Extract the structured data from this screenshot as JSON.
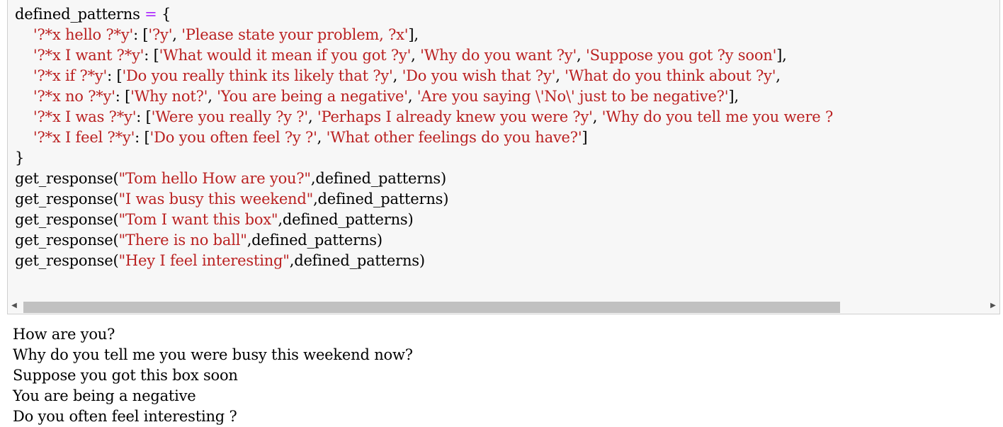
{
  "code": {
    "lines": [
      [
        {
          "t": "defined_patterns ",
          "c": ""
        },
        {
          "t": "=",
          "c": "op"
        },
        {
          "t": " {",
          "c": ""
        }
      ],
      [
        {
          "t": "    ",
          "c": ""
        },
        {
          "t": "'?*x hello ?*y'",
          "c": "str"
        },
        {
          "t": ": [",
          "c": ""
        },
        {
          "t": "'?y'",
          "c": "str"
        },
        {
          "t": ", ",
          "c": ""
        },
        {
          "t": "'Please state your problem, ?x'",
          "c": "str"
        },
        {
          "t": "],",
          "c": ""
        }
      ],
      [
        {
          "t": "    ",
          "c": ""
        },
        {
          "t": "'?*x I want ?*y'",
          "c": "str"
        },
        {
          "t": ": [",
          "c": ""
        },
        {
          "t": "'What would it mean if you got ?y'",
          "c": "str"
        },
        {
          "t": ", ",
          "c": ""
        },
        {
          "t": "'Why do you want ?y'",
          "c": "str"
        },
        {
          "t": ", ",
          "c": ""
        },
        {
          "t": "'Suppose you got ?y soon'",
          "c": "str"
        },
        {
          "t": "],",
          "c": ""
        }
      ],
      [
        {
          "t": "    ",
          "c": ""
        },
        {
          "t": "'?*x if ?*y'",
          "c": "str"
        },
        {
          "t": ": [",
          "c": ""
        },
        {
          "t": "'Do you really think its likely that ?y'",
          "c": "str"
        },
        {
          "t": ", ",
          "c": ""
        },
        {
          "t": "'Do you wish that ?y'",
          "c": "str"
        },
        {
          "t": ", ",
          "c": ""
        },
        {
          "t": "'What do you think about ?y'",
          "c": "str"
        },
        {
          "t": ",",
          "c": ""
        }
      ],
      [
        {
          "t": "    ",
          "c": ""
        },
        {
          "t": "'?*x no ?*y'",
          "c": "str"
        },
        {
          "t": ": [",
          "c": ""
        },
        {
          "t": "'Why not?'",
          "c": "str"
        },
        {
          "t": ", ",
          "c": ""
        },
        {
          "t": "'You are being a negative'",
          "c": "str"
        },
        {
          "t": ", ",
          "c": ""
        },
        {
          "t": "'Are you saying \\'No\\' just to be negative?'",
          "c": "str"
        },
        {
          "t": "],",
          "c": ""
        }
      ],
      [
        {
          "t": "    ",
          "c": ""
        },
        {
          "t": "'?*x I was ?*y'",
          "c": "str"
        },
        {
          "t": ": [",
          "c": ""
        },
        {
          "t": "'Were you really ?y ?'",
          "c": "str"
        },
        {
          "t": ", ",
          "c": ""
        },
        {
          "t": "'Perhaps I already knew you were ?y'",
          "c": "str"
        },
        {
          "t": ", ",
          "c": ""
        },
        {
          "t": "'Why do you tell me you were ?",
          "c": "str"
        }
      ],
      [
        {
          "t": "    ",
          "c": ""
        },
        {
          "t": "'?*x I feel ?*y'",
          "c": "str"
        },
        {
          "t": ": [",
          "c": ""
        },
        {
          "t": "'Do you often feel ?y ?'",
          "c": "str"
        },
        {
          "t": ", ",
          "c": ""
        },
        {
          "t": "'What other feelings do you have?'",
          "c": "str"
        },
        {
          "t": "]",
          "c": ""
        }
      ],
      [
        {
          "t": "}",
          "c": ""
        }
      ],
      [
        {
          "t": "get_response(",
          "c": ""
        },
        {
          "t": "\"Tom hello How are you?\"",
          "c": "str"
        },
        {
          "t": ",defined_patterns)",
          "c": ""
        }
      ],
      [
        {
          "t": "get_response(",
          "c": ""
        },
        {
          "t": "\"I was busy this weekend\"",
          "c": "str"
        },
        {
          "t": ",defined_patterns)",
          "c": ""
        }
      ],
      [
        {
          "t": "get_response(",
          "c": ""
        },
        {
          "t": "\"Tom I want this box\"",
          "c": "str"
        },
        {
          "t": ",defined_patterns)",
          "c": ""
        }
      ],
      [
        {
          "t": "get_response(",
          "c": ""
        },
        {
          "t": "\"There is no ball\"",
          "c": "str"
        },
        {
          "t": ",defined_patterns)",
          "c": ""
        }
      ],
      [
        {
          "t": "get_response(",
          "c": ""
        },
        {
          "t": "\"Hey I feel interesting\"",
          "c": "str"
        },
        {
          "t": ",defined_patterns)",
          "c": ""
        }
      ]
    ]
  },
  "scrollbar": {
    "left_arrow": "◀",
    "right_arrow": "▶",
    "position_fraction": 0.0,
    "visible_fraction": 0.85
  },
  "output": {
    "lines": [
      "How are you?",
      "Why do you tell me you were busy this weekend now?",
      "Suppose you got this box soon",
      "You are being a negative",
      "Do you often feel interesting ?"
    ]
  },
  "colors": {
    "string": "#ba2121",
    "operator": "#aa22ff",
    "cell_background": "#f7f7f7",
    "border": "#cfcfcf"
  }
}
